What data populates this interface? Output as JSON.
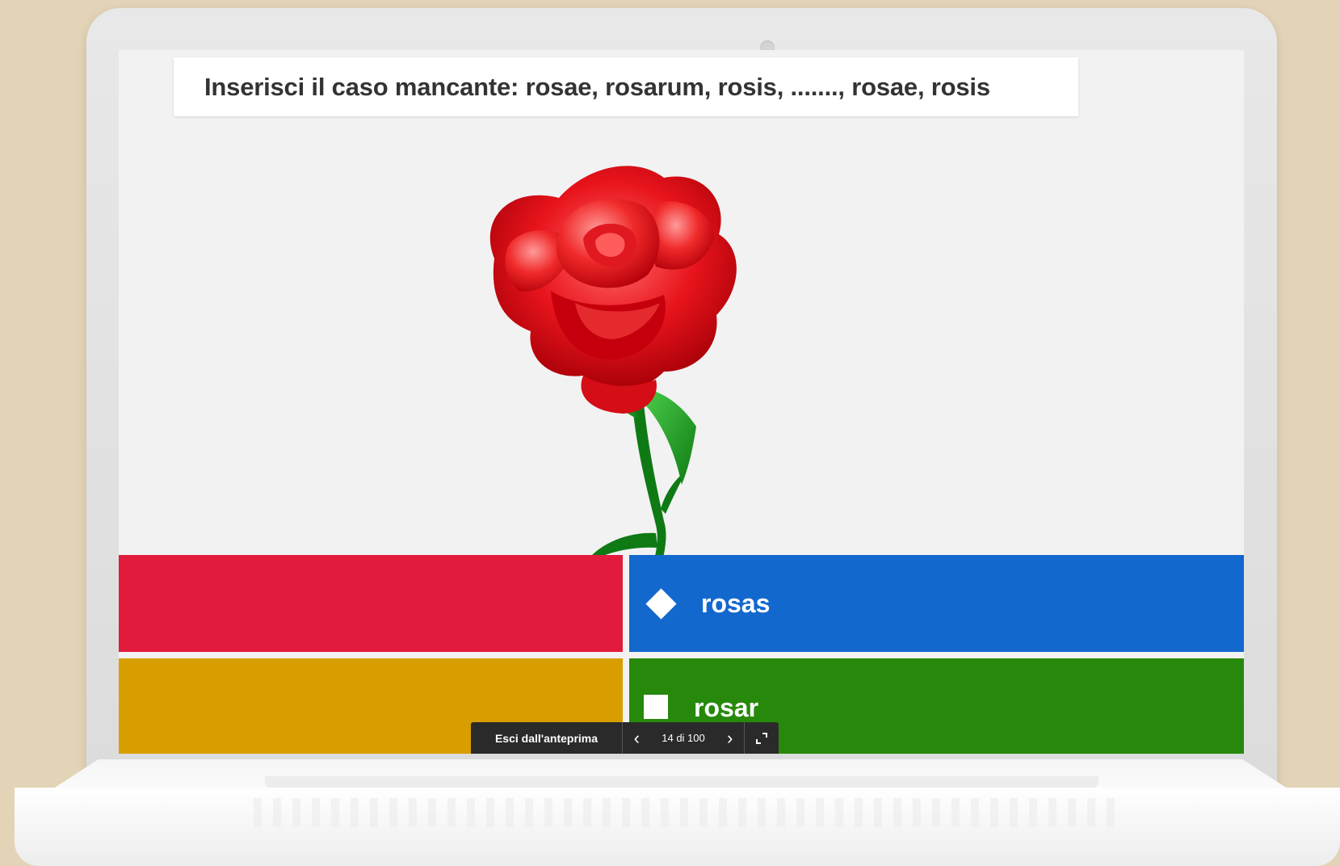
{
  "question": {
    "text": "Inserisci il caso mancante: rosae, rosarum, rosis, ......., rosae, rosis"
  },
  "media": {
    "image_subject": "red-rose-icon"
  },
  "answers": [
    {
      "color": "#e21b3c",
      "shape": "triangle",
      "label": ""
    },
    {
      "color": "#1368ce",
      "shape": "diamond",
      "label": "rosas"
    },
    {
      "color": "#d89e00",
      "shape": "circle",
      "label": ""
    },
    {
      "color": "#26890c",
      "shape": "square",
      "label": "rosar"
    }
  ],
  "preview_toolbar": {
    "exit_label": "Esci dall'anteprima",
    "page_indicator": "14 di 100",
    "prev_icon": "chevron-left-icon",
    "next_icon": "chevron-right-icon",
    "fullscreen_icon": "fullscreen-icon"
  }
}
